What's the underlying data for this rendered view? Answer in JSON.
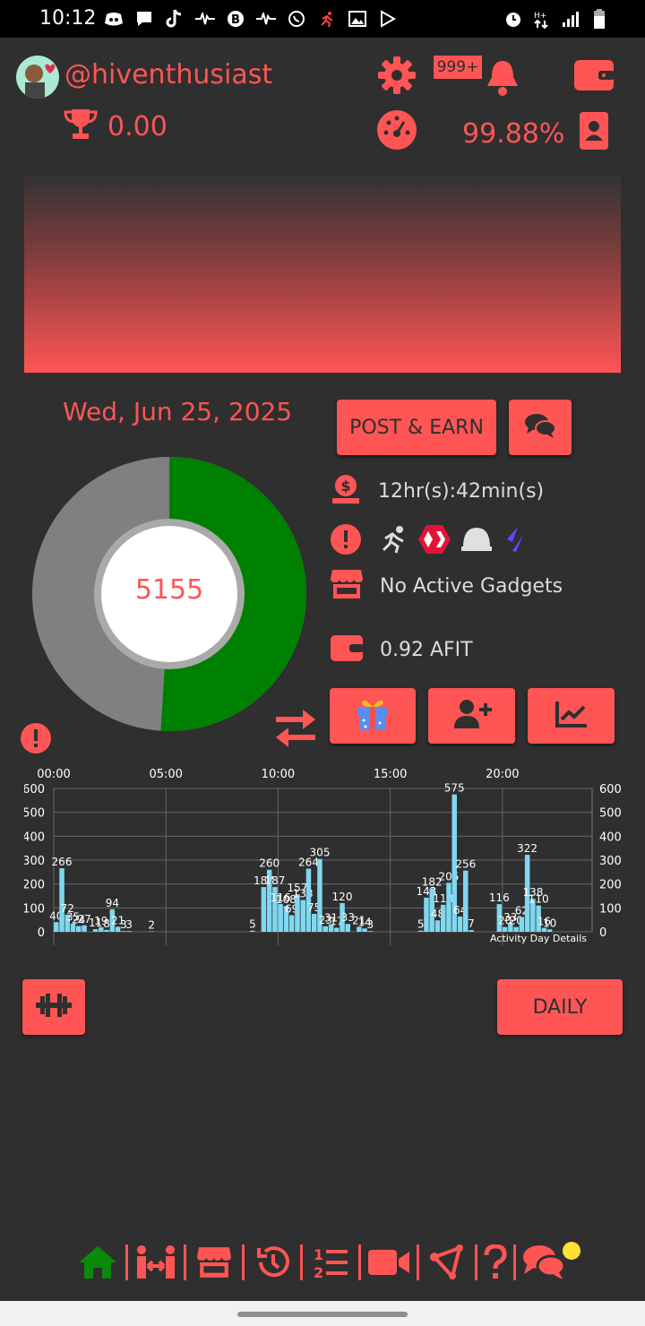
{
  "status_bar": {
    "time": "10:12"
  },
  "header": {
    "username": "@hiventhusiast",
    "trophy_score": "0.00",
    "notification_badge": "999+",
    "efficiency": "99.88%"
  },
  "activity": {
    "date": "Wed, Jun 25, 2025",
    "steps": "5155",
    "progress_fraction": 0.51,
    "post_earn_label": "POST & EARN",
    "time_remaining": "12hr(s):42min(s)",
    "gadgets": "No Active Gadgets",
    "wallet_balance": "0.92 AFIT"
  },
  "buttons": {
    "daily_label": "DAILY"
  },
  "colors": {
    "accent": "#ff5555",
    "progress": "#008000",
    "track": "#808080",
    "bars": "#7fd8f0",
    "background": "#2f2f2f"
  },
  "chart_data": {
    "type": "bar",
    "title": "",
    "annotation": "Activity Day Details",
    "x_ticks": [
      "00:00",
      "05:00",
      "10:00",
      "15:00",
      "20:00"
    ],
    "x_range": [
      0,
      24
    ],
    "y_ticks": [
      0,
      100,
      200,
      300,
      400,
      500,
      600
    ],
    "ylim": [
      0,
      600
    ],
    "bars": [
      {
        "x": 0.0,
        "v": 40
      },
      {
        "x": 0.25,
        "v": 266
      },
      {
        "x": 0.5,
        "v": 72
      },
      {
        "x": 0.75,
        "v": 35
      },
      {
        "x": 1.0,
        "v": 24
      },
      {
        "x": 1.25,
        "v": 27
      },
      {
        "x": 1.75,
        "v": 11
      },
      {
        "x": 2.0,
        "v": 19
      },
      {
        "x": 2.25,
        "v": 8
      },
      {
        "x": 2.5,
        "v": 94
      },
      {
        "x": 2.75,
        "v": 21
      },
      {
        "x": 3.0,
        "v": 3
      },
      {
        "x": 3.25,
        "v": 3
      },
      {
        "x": 4.25,
        "v": 2
      },
      {
        "x": 8.75,
        "v": 5
      },
      {
        "x": 9.25,
        "v": 187
      },
      {
        "x": 9.5,
        "v": 260
      },
      {
        "x": 9.75,
        "v": 187
      },
      {
        "x": 10.0,
        "v": 116
      },
      {
        "x": 10.25,
        "v": 108
      },
      {
        "x": 10.5,
        "v": 69
      },
      {
        "x": 10.75,
        "v": 157
      },
      {
        "x": 11.0,
        "v": 133
      },
      {
        "x": 11.25,
        "v": 264
      },
      {
        "x": 11.5,
        "v": 75
      },
      {
        "x": 11.75,
        "v": 305
      },
      {
        "x": 12.0,
        "v": 23
      },
      {
        "x": 12.25,
        "v": 31
      },
      {
        "x": 12.5,
        "v": 17
      },
      {
        "x": 12.75,
        "v": 120
      },
      {
        "x": 13.0,
        "v": 33
      },
      {
        "x": 13.5,
        "v": 21
      },
      {
        "x": 13.75,
        "v": 14
      },
      {
        "x": 14.0,
        "v": 3
      },
      {
        "x": 16.25,
        "v": 5
      },
      {
        "x": 16.5,
        "v": 143
      },
      {
        "x": 16.75,
        "v": 182
      },
      {
        "x": 17.0,
        "v": 48
      },
      {
        "x": 17.25,
        "v": 113
      },
      {
        "x": 17.5,
        "v": 205
      },
      {
        "x": 17.75,
        "v": 575
      },
      {
        "x": 18.0,
        "v": 64
      },
      {
        "x": 18.25,
        "v": 256
      },
      {
        "x": 18.5,
        "v": 7
      },
      {
        "x": 19.75,
        "v": 116
      },
      {
        "x": 20.0,
        "v": 20
      },
      {
        "x": 20.25,
        "v": 33
      },
      {
        "x": 20.5,
        "v": 20
      },
      {
        "x": 20.75,
        "v": 62
      },
      {
        "x": 21.0,
        "v": 322
      },
      {
        "x": 21.25,
        "v": 138
      },
      {
        "x": 21.5,
        "v": 110
      },
      {
        "x": 21.75,
        "v": 16
      },
      {
        "x": 22.0,
        "v": 10
      }
    ]
  },
  "icons": {
    "settings": "gear-icon",
    "bell": "bell-icon",
    "wallet": "wallet-icon",
    "trophy": "trophy-icon",
    "gauge": "gauge-icon",
    "id_card": "id-card-icon",
    "chat": "chat-icon",
    "gift": "gift-icon",
    "add_user": "add-user-icon",
    "chart": "line-chart-icon",
    "dumbbell": "dumbbell-icon",
    "swap": "swap-icon",
    "alert": "alert-icon"
  }
}
